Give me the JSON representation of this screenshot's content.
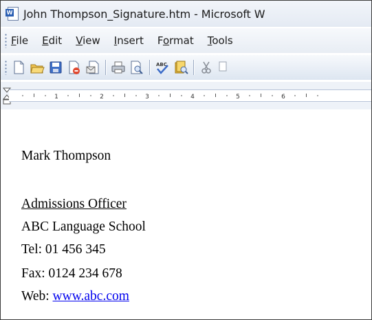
{
  "window": {
    "title": "John Thompson_Signature.htm - Microsoft W"
  },
  "menu": {
    "items": [
      {
        "underline": "F",
        "rest": "ile"
      },
      {
        "underline": "E",
        "rest": "dit"
      },
      {
        "underline": "V",
        "rest": "iew"
      },
      {
        "underline": "I",
        "rest": "nsert"
      },
      {
        "pre": "F",
        "underline": "o",
        "rest": "rmat"
      },
      {
        "underline": "T",
        "rest": "ools"
      }
    ]
  },
  "toolbar": {
    "icons": [
      "new-document-icon",
      "open-folder-icon",
      "save-icon",
      "permission-icon",
      "email-icon",
      "print-icon",
      "print-preview-icon",
      "spelling-icon",
      "research-icon",
      "cut-icon"
    ]
  },
  "ruler": {
    "labels": [
      "1",
      "2",
      "3",
      "4",
      "5",
      "6"
    ]
  },
  "document": {
    "name": "Mark Thompson",
    "position": "Admissions Officer",
    "company": "ABC Language School",
    "tel": "Tel: 01 456 345",
    "fax": "Fax: 0124 234 678",
    "web_label": "Web: ",
    "web_link": "www.abc.com"
  },
  "colors": {
    "link": "#0000ee",
    "word_blue": "#2b5fb3"
  }
}
